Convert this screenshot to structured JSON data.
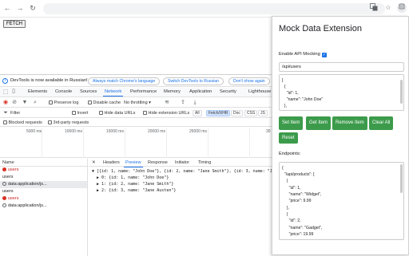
{
  "browser": {
    "back_glyph": "←",
    "forward_glyph": "→",
    "reload_glyph": "↻",
    "icons": [
      "translate-icon",
      "star-icon",
      "extension-icon"
    ]
  },
  "page": {
    "fetch_label": "FETCH"
  },
  "devtools": {
    "info_text": "DevTools is now available in Russian!",
    "info_buttons": [
      "Always match Chrome's language",
      "Switch DevTools to Russian",
      "Don't show again"
    ],
    "tabs": [
      "Elements",
      "Console",
      "Sources",
      "Network",
      "Performance",
      "Memory",
      "Application",
      "Security",
      "Lighthouse"
    ],
    "active_tab": "Network",
    "toolbar": {
      "preserve_log": "Preserve log",
      "disable_cache": "Disable cache",
      "throttling": "No throttling"
    },
    "filter": {
      "placeholder": "Filter",
      "invert": "Invert",
      "hide_data_urls": "Hide data URLs",
      "hide_extension_urls": "Hide extension URLs",
      "chips": [
        "All",
        "Fetch/XHR",
        "Doc",
        "CSS",
        "JS"
      ],
      "active_chip": "Fetch/XHR"
    },
    "blocked": {
      "blocked_requests": "Blocked requests",
      "third_party": "3rd-party requests"
    },
    "timeline_ticks": [
      "5000 ms",
      "10000 ms",
      "15000 ms",
      "20000 ms",
      "25000 ms",
      "30"
    ],
    "list_header": "Name",
    "requests": [
      {
        "name": "users",
        "status": "error"
      },
      {
        "name": "users",
        "status": "ok"
      },
      {
        "name": "data:application/js...",
        "status": "ok",
        "selected": true
      },
      {
        "name": "users",
        "status": "ok"
      },
      {
        "name": "users",
        "status": "error"
      },
      {
        "name": "data:application/js...",
        "status": "ok"
      }
    ],
    "detail_tabs": [
      "Headers",
      "Preview",
      "Response",
      "Initiator",
      "Timing"
    ],
    "active_detail_tab": "Preview",
    "preview_lines": [
      "▼ [{id: 1, name: \"John Doe\"}, {id: 2, name: \"Jane Smith\"}, {id: 3, name: \"Jane",
      "  ▶ 0: {id: 1, name: \"John Doe\"}",
      "  ▶ 1: {id: 2, name: \"Jane Smith\"}",
      "  ▶ 2: {id: 3, name: \"Jane Austen\"}"
    ]
  },
  "extension": {
    "title": "Mock Data Extension",
    "enable_label": "Enable API Mocking",
    "enable_checked": true,
    "url_value": "/api/users",
    "json_lines": [
      "[",
      "  {",
      "    \"id\": 1,",
      "    \"name\": \"John Doe\"",
      "  },"
    ],
    "buttons": [
      "Set Item",
      "Get Item",
      "Remove Item",
      "Clear All"
    ],
    "reset_label": "Reset",
    "endpoints_label": "Endpoints:",
    "endpoint_lines": [
      "{",
      "  \"/api/products\": [",
      "    {",
      "      \"id\": 1,",
      "      \"name\": \"Widget\",",
      "      \"price\": 9.99",
      "    },",
      "    {",
      "      \"id\": 2,",
      "      \"name\": \"Gadget\",",
      "      \"price\": 19.99"
    ],
    "accent_color": "#3c9b4b"
  }
}
